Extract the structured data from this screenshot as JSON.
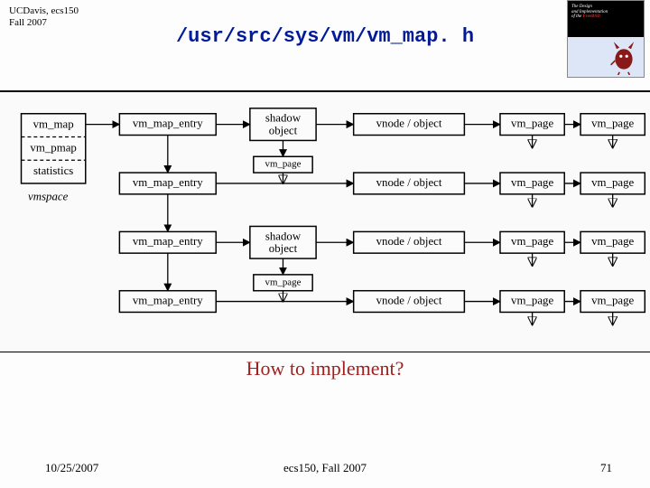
{
  "header": {
    "course": "UCDavis, ecs150",
    "term": "Fall 2007"
  },
  "title": "/usr/src/sys/vm/vm_map. h",
  "subtitle": "How to implement?",
  "footer": {
    "date": "10/25/2007",
    "mid": "ecs150, Fall 2007",
    "page": "71"
  },
  "book": {
    "line1": "The Design",
    "line2": "and Implementation",
    "line3": "of the",
    "brand": "FreeBSD"
  },
  "left": {
    "b1": "vm_map",
    "b2": "vm_pmap",
    "b3": "statistics",
    "caption": "vmspace"
  },
  "boxes": {
    "vme": "vm_map_entry",
    "shadow1": "shadow",
    "shadow2": "object",
    "vmpage": "vm_page",
    "vnode": "vnode / object"
  }
}
